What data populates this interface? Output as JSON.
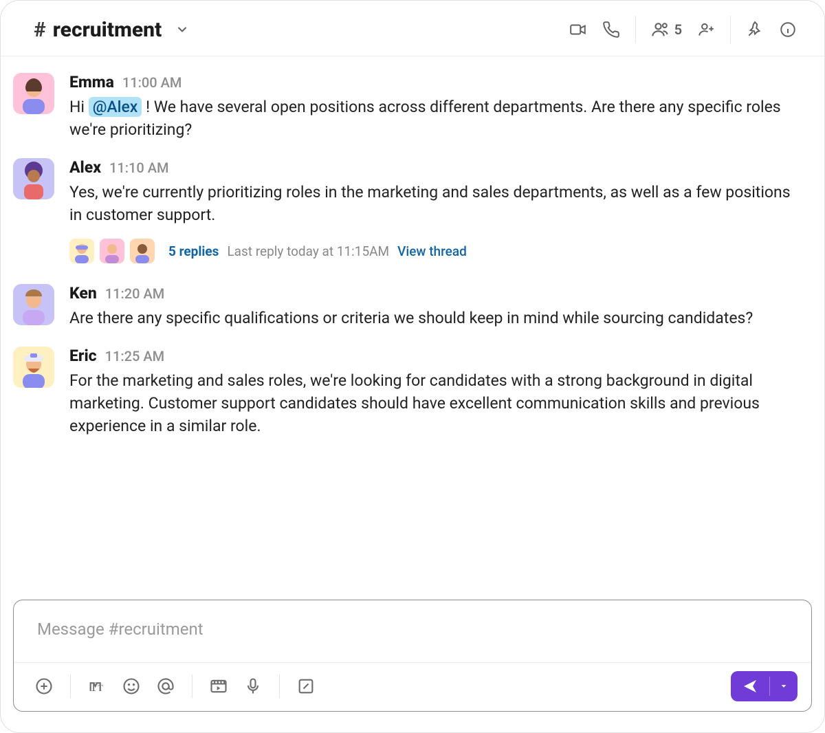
{
  "header": {
    "channel_prefix": "#",
    "channel_name": "recruitment",
    "member_count": "5"
  },
  "messages": [
    {
      "author": "Emma",
      "time": "11:00 AM",
      "text_before": "Hi ",
      "mention": "@Alex",
      "text_after": " ! We have several open positions across different departments. Are there any specific roles we're prioritizing?",
      "avatar": "pink-woman"
    },
    {
      "author": "Alex",
      "time": "11:10 AM",
      "text": "Yes, we're currently prioritizing roles in the marketing and sales departments, as well as a few positions in customer support.",
      "avatar": "purple-afro",
      "thread": {
        "replies_label": "5 replies",
        "last_reply": "Last reply today at 11:15AM",
        "view_label": "View thread"
      }
    },
    {
      "author": "Ken",
      "time": "11:20 AM",
      "text": "Are there any specific qualifications or criteria we should keep in mind while sourcing candidates?",
      "avatar": "lilac-man"
    },
    {
      "author": "Eric",
      "time": "11:25 AM",
      "text": "For the marketing and sales roles, we're looking for candidates with a strong background in digital marketing. Customer support candidates should have excellent communication skills and previous experience in a similar role.",
      "avatar": "yellow-cap"
    }
  ],
  "composer": {
    "placeholder": "Message #recruitment"
  }
}
